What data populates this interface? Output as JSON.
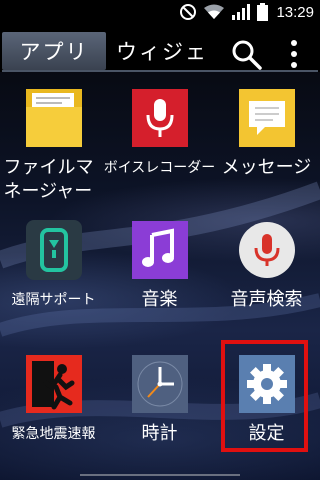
{
  "status_bar": {
    "time": "13:29",
    "icons": [
      "do-not-disturb-icon",
      "wifi-icon",
      "signal-icon",
      "battery-icon"
    ]
  },
  "tabs": {
    "apps_label": "アプリ",
    "widgets_label": "ウィジェ",
    "icons": [
      "search-icon",
      "overflow-menu-icon"
    ]
  },
  "apps": [
    {
      "label": "ファイルマネージャー",
      "icon": "folder-icon",
      "color": "#f3c531"
    },
    {
      "label": "ボイスレコーダー",
      "icon": "microphone-icon",
      "color": "#d51f2c"
    },
    {
      "label": "メッセージ",
      "icon": "message-icon",
      "color": "#f3c531"
    },
    {
      "label": "遠隔サポート",
      "icon": "remote-support-icon",
      "color": "#1c9e84"
    },
    {
      "label": "音楽",
      "icon": "music-icon",
      "color": "#8b3dd6"
    },
    {
      "label": "音声検索",
      "icon": "voice-search-icon",
      "color": "#e8e8e8"
    },
    {
      "label": "緊急地震速報",
      "icon": "emergency-exit-icon",
      "color": "#e62a1e"
    },
    {
      "label": "時計",
      "icon": "clock-icon",
      "color": "#4f6080"
    },
    {
      "label": "設定",
      "icon": "gear-icon",
      "color": "#5a7fb0"
    }
  ],
  "highlight_color": "#e01010"
}
